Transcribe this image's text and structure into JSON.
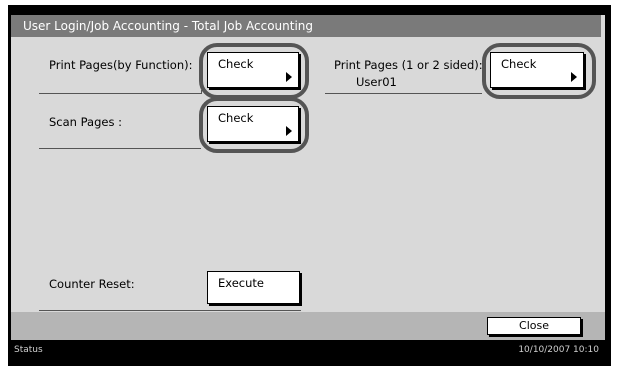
{
  "title": "User Login/Job Accounting - Total Job Accounting",
  "print_function": {
    "label": "Print Pages(by Function):",
    "button": "Check"
  },
  "print_sided": {
    "label": "Print Pages (1 or 2 sided):",
    "user": "User01",
    "button": "Check"
  },
  "scan": {
    "label": "Scan Pages :",
    "button": "Check"
  },
  "counter_reset": {
    "label": "Counter Reset:",
    "button": "Execute"
  },
  "close_button": "Close",
  "status": {
    "label": "Status",
    "datetime": "10/10/2007  10:10"
  },
  "colors": {
    "title_bar": "#7a7a7a",
    "panel": "#d9d9d9",
    "highlight_ring": "#555555",
    "status_bar": "#000000"
  }
}
